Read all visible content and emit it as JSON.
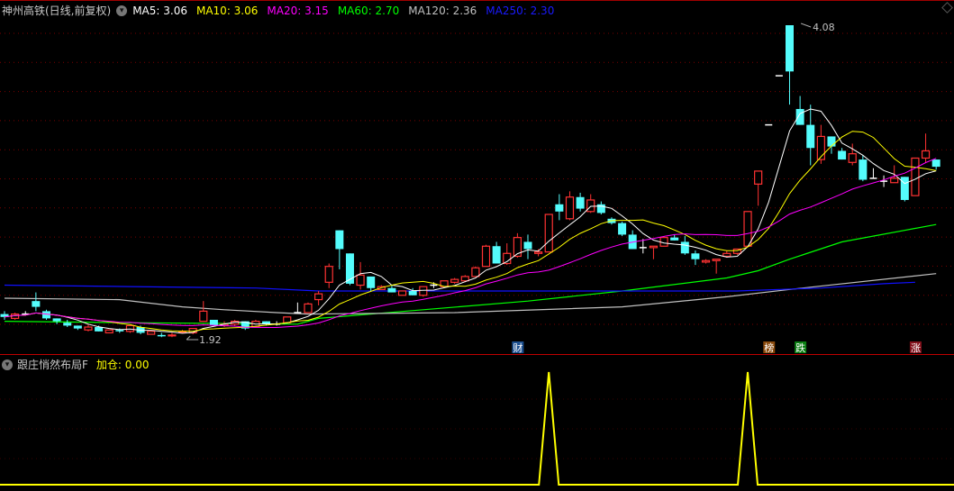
{
  "header": {
    "title": "神州高铁(日线,前复权)",
    "ma": [
      {
        "name": "MA5",
        "value": "3.06",
        "color": "#ffffff"
      },
      {
        "name": "MA10",
        "value": "3.06",
        "color": "#ffff00"
      },
      {
        "name": "MA20",
        "value": "3.15",
        "color": "#ff00ff"
      },
      {
        "name": "MA60",
        "value": "2.70",
        "color": "#00ff00"
      },
      {
        "name": "MA120",
        "value": "2.36",
        "color": "#c0c0c0"
      },
      {
        "name": "MA250",
        "value": "2.30",
        "color": "#0000ff"
      }
    ]
  },
  "indicator": {
    "title": "跟庄悄然布局F",
    "series_label": "加仓",
    "value": "0.00",
    "color": "#ffff00"
  },
  "chart_data": [
    {
      "type": "candlestick",
      "title": "神州高铁(日线,前复权)",
      "ylim": [
        1.82,
        4.13
      ],
      "grid": true,
      "colors": {
        "up": "#ff3232",
        "down": "#54fcfc",
        "doji": "#ffffff"
      },
      "ohlc": [
        [
          2.08,
          2.1,
          2.04,
          2.06
        ],
        [
          2.05,
          2.09,
          2.04,
          2.08
        ],
        [
          2.08,
          2.1,
          2.07,
          2.08
        ],
        [
          2.17,
          2.23,
          2.1,
          2.13
        ],
        [
          2.1,
          2.11,
          2.04,
          2.05
        ],
        [
          2.05,
          2.05,
          2.01,
          2.03
        ],
        [
          2.02,
          2.04,
          1.99,
          2.0
        ],
        [
          2.0,
          2.0,
          1.97,
          1.98
        ],
        [
          1.97,
          2.01,
          1.96,
          1.99
        ],
        [
          1.99,
          2.0,
          1.96,
          1.96
        ],
        [
          1.95,
          1.97,
          1.95,
          1.97
        ],
        [
          1.97,
          1.98,
          1.95,
          1.96
        ],
        [
          1.96,
          2.0,
          1.95,
          2.0
        ],
        [
          1.99,
          2.0,
          1.94,
          1.95
        ],
        [
          1.94,
          1.96,
          1.94,
          1.96
        ],
        [
          1.935,
          1.95,
          1.92,
          1.93
        ],
        [
          1.93,
          1.95,
          1.92,
          1.935
        ],
        [
          1.955,
          1.97,
          1.95,
          1.96
        ],
        [
          1.95,
          1.98,
          1.94,
          1.98
        ],
        [
          2.03,
          2.17,
          2.03,
          2.1
        ],
        [
          2.04,
          2.04,
          2.0,
          2.0
        ],
        [
          2.0,
          2.03,
          1.99,
          2.01
        ],
        [
          2.01,
          2.04,
          2.0,
          2.03
        ],
        [
          2.03,
          2.03,
          1.97,
          1.98
        ],
        [
          1.99,
          2.04,
          1.99,
          2.03
        ],
        [
          2.03,
          2.03,
          2.0,
          2.01
        ],
        [
          2.01,
          2.03,
          2.0,
          2.01
        ],
        [
          2.02,
          2.06,
          2.02,
          2.06
        ],
        [
          2.09,
          2.16,
          2.09,
          2.09
        ],
        [
          2.09,
          2.16,
          2.09,
          2.15
        ],
        [
          2.18,
          2.24,
          2.14,
          2.22
        ],
        [
          2.3,
          2.43,
          2.26,
          2.41
        ],
        [
          2.66,
          2.66,
          2.39,
          2.53
        ],
        [
          2.5,
          2.5,
          2.28,
          2.29
        ],
        [
          2.28,
          2.44,
          2.25,
          2.35
        ],
        [
          2.34,
          2.34,
          2.24,
          2.26
        ],
        [
          2.25,
          2.28,
          2.25,
          2.27
        ],
        [
          2.26,
          2.28,
          2.23,
          2.23
        ],
        [
          2.21,
          2.24,
          2.21,
          2.24
        ],
        [
          2.24,
          2.26,
          2.21,
          2.21
        ],
        [
          2.21,
          2.27,
          2.2,
          2.27
        ],
        [
          2.28,
          2.3,
          2.26,
          2.28
        ],
        [
          2.27,
          2.31,
          2.26,
          2.31
        ],
        [
          2.3,
          2.33,
          2.29,
          2.32
        ],
        [
          2.31,
          2.35,
          2.3,
          2.34
        ],
        [
          2.34,
          2.41,
          2.34,
          2.4
        ],
        [
          2.41,
          2.56,
          2.41,
          2.55
        ],
        [
          2.55,
          2.58,
          2.43,
          2.43
        ],
        [
          2.43,
          2.57,
          2.42,
          2.5
        ],
        [
          2.48,
          2.64,
          2.47,
          2.61
        ],
        [
          2.58,
          2.63,
          2.46,
          2.53
        ],
        [
          2.5,
          2.53,
          2.48,
          2.51
        ],
        [
          2.51,
          2.77,
          2.51,
          2.77
        ],
        [
          2.84,
          2.91,
          2.73,
          2.79
        ],
        [
          2.74,
          2.93,
          2.73,
          2.89
        ],
        [
          2.89,
          2.92,
          2.79,
          2.81
        ],
        [
          2.79,
          2.91,
          2.78,
          2.87
        ],
        [
          2.84,
          2.86,
          2.77,
          2.78
        ],
        [
          2.74,
          2.75,
          2.7,
          2.71
        ],
        [
          2.71,
          2.72,
          2.62,
          2.63
        ],
        [
          2.63,
          2.66,
          2.53,
          2.53
        ],
        [
          2.54,
          2.6,
          2.5,
          2.54
        ],
        [
          2.54,
          2.55,
          2.46,
          2.55
        ],
        [
          2.55,
          2.62,
          2.55,
          2.61
        ],
        [
          2.61,
          2.63,
          2.59,
          2.59
        ],
        [
          2.58,
          2.62,
          2.49,
          2.5
        ],
        [
          2.5,
          2.52,
          2.42,
          2.46
        ],
        [
          2.44,
          2.46,
          2.43,
          2.45
        ],
        [
          2.45,
          2.46,
          2.36,
          2.46
        ],
        [
          2.48,
          2.52,
          2.47,
          2.5
        ],
        [
          2.5,
          2.53,
          2.49,
          2.53
        ],
        [
          2.55,
          2.79,
          2.55,
          2.79
        ],
        [
          2.98,
          3.07,
          2.83,
          3.07
        ],
        [
          3.39,
          3.39,
          3.39,
          3.39
        ],
        [
          3.73,
          3.73,
          3.73,
          3.73
        ],
        [
          4.08,
          4.08,
          3.53,
          3.76
        ],
        [
          3.5,
          3.59,
          3.39,
          3.39
        ],
        [
          3.39,
          3.53,
          3.11,
          3.23
        ],
        [
          3.15,
          3.39,
          3.12,
          3.31
        ],
        [
          3.31,
          3.31,
          3.19,
          3.24
        ],
        [
          3.21,
          3.23,
          3.15,
          3.15
        ],
        [
          3.13,
          3.26,
          3.11,
          3.19
        ],
        [
          3.15,
          3.18,
          3.0,
          3.01
        ],
        [
          3.02,
          3.09,
          3.02,
          3.02
        ],
        [
          3.0,
          3.04,
          2.96,
          3.0
        ],
        [
          2.99,
          3.11,
          2.99,
          3.02
        ],
        [
          3.03,
          3.03,
          2.86,
          2.87
        ],
        [
          2.9,
          3.16,
          2.9,
          3.16
        ],
        [
          3.16,
          3.33,
          3.13,
          3.21
        ],
        [
          3.15,
          3.15,
          3.08,
          3.1
        ]
      ],
      "moving_averages_computed": [
        {
          "name": "MA5",
          "period": 5,
          "color": "#ffffff"
        },
        {
          "name": "MA10",
          "period": 10,
          "color": "#ffff00"
        },
        {
          "name": "MA20",
          "period": 20,
          "color": "#ff00ff"
        }
      ],
      "moving_averages_points": [
        {
          "name": "MA60",
          "color": "#00ff00",
          "points": [
            [
              0,
              2.03
            ],
            [
              12,
              2.02
            ],
            [
              28,
              2.01
            ],
            [
              30,
              2.05
            ],
            [
              40,
              2.11
            ],
            [
              50,
              2.17
            ],
            [
              59,
              2.24
            ],
            [
              69,
              2.33
            ],
            [
              72,
              2.38
            ],
            [
              75,
              2.46
            ],
            [
              80,
              2.58
            ],
            [
              89,
              2.7
            ]
          ]
        },
        {
          "name": "MA120",
          "color": "#c0c0c0",
          "points": [
            [
              0,
              2.19
            ],
            [
              11,
              2.18
            ],
            [
              17,
              2.13
            ],
            [
              21,
              2.11
            ],
            [
              26,
              2.09
            ],
            [
              29,
              2.08
            ],
            [
              43,
              2.09
            ],
            [
              59,
              2.13
            ],
            [
              69,
              2.2
            ],
            [
              75,
              2.25
            ],
            [
              89,
              2.36
            ]
          ]
        },
        {
          "name": "MA250",
          "color": "#1010ff",
          "points": [
            [
              0,
              2.28
            ],
            [
              12,
              2.27
            ],
            [
              24,
              2.26
            ],
            [
              30,
              2.24
            ],
            [
              70,
              2.24
            ],
            [
              78,
              2.26
            ],
            [
              84,
              2.29
            ],
            [
              87,
              2.3
            ]
          ]
        }
      ],
      "annotations": [
        {
          "label": "4.08",
          "index": 76,
          "price": 4.08,
          "kind": "high"
        },
        {
          "label": "1.92",
          "index": 18,
          "price": 1.92,
          "kind": "low"
        }
      ],
      "markers": [
        {
          "label": "财",
          "index": 49,
          "color": "#1c4f8f"
        },
        {
          "label": "榜",
          "index": 73,
          "color": "#8a4a0c"
        },
        {
          "label": "跌",
          "index": 76,
          "color": "#0a7d12"
        },
        {
          "label": "涨",
          "index": 87,
          "color": "#80101a"
        }
      ]
    },
    {
      "type": "line",
      "title": "跟庄悄然布局F",
      "series": [
        {
          "name": "加仓",
          "color": "#ffff00",
          "spikes_at_index": [
            52,
            71
          ],
          "baseline": 0,
          "spike_value": 1
        }
      ],
      "ylim": [
        0,
        1
      ]
    }
  ]
}
